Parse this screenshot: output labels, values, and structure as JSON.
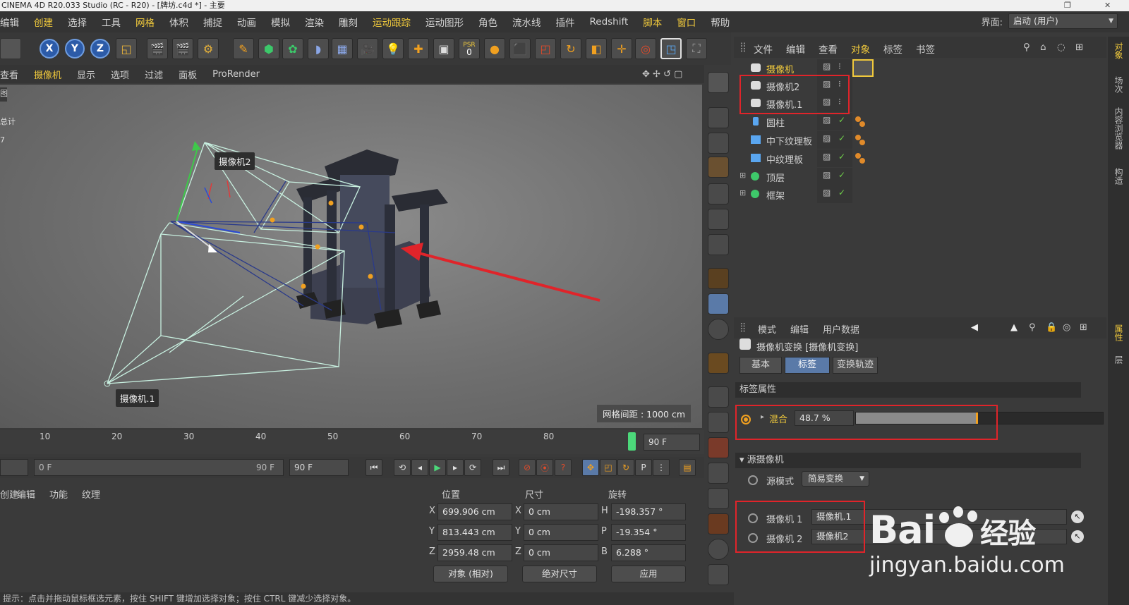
{
  "window": {
    "title": "CINEMA 4D R20.033 Studio (RC - R20) - [牌坊.c4d *] - 主要"
  },
  "menubar": {
    "items": [
      "编辑",
      "创建",
      "选择",
      "工具",
      "网格",
      "体积",
      "捕捉",
      "动画",
      "模拟",
      "渲染",
      "雕刻",
      "运动跟踪",
      "运动图形",
      "角色",
      "流水线",
      "插件",
      "Redshift",
      "脚本",
      "窗口",
      "帮助"
    ],
    "highlight_color": "#f0c93c"
  },
  "interface": {
    "label": "界面:",
    "value": "启动 (用户)"
  },
  "toolbar": {
    "axis_x": "X",
    "axis_y": "Y",
    "axis_z": "Z",
    "psr_label": "PSR",
    "psr_value": "0"
  },
  "viewport_menu": {
    "items": [
      "查看",
      "摄像机",
      "显示",
      "选项",
      "过滤",
      "面板",
      "ProRender"
    ]
  },
  "viewport": {
    "side_text_1": "图",
    "side_text_2": "总计",
    "side_text_3": "7",
    "cam2_label": "摄像机2",
    "cam1_label": "摄像机.1",
    "grid_info": "网格间距 : 1000 cm"
  },
  "timeline": {
    "ticks": [
      "10",
      "20",
      "30",
      "40",
      "50",
      "60",
      "70",
      "80"
    ],
    "current_frame": "90 F"
  },
  "transport": {
    "start_field": "0 F",
    "range_start": "0 F",
    "range_end": "90 F",
    "end_field": "90 F"
  },
  "material_menu": {
    "items": [
      "创建",
      "编辑",
      "功能",
      "纹理"
    ]
  },
  "coords": {
    "headers": {
      "position": "位置",
      "size": "尺寸",
      "rotation": "旋转"
    },
    "rows": [
      {
        "p_axis": "X",
        "p_val": "699.906 cm",
        "s_axis": "X",
        "s_val": "0 cm",
        "r_axis": "H",
        "r_val": "-198.357 °"
      },
      {
        "p_axis": "Y",
        "p_val": "813.443 cm",
        "s_axis": "Y",
        "s_val": "0 cm",
        "r_axis": "P",
        "r_val": "-19.354 °"
      },
      {
        "p_axis": "Z",
        "p_val": "2959.48 cm",
        "s_axis": "Z",
        "s_val": "0 cm",
        "r_axis": "B",
        "r_val": "6.288 °"
      }
    ],
    "mode_select": "对象 (相对)",
    "size_select": "绝对尺寸",
    "apply_button": "应用"
  },
  "status": {
    "text": "提示：点击并拖动鼠标框选元素，按住 SHIFT 键增加选择对象；按住 CTRL 键减少选择对象。"
  },
  "object_menu": {
    "items": [
      "文件",
      "编辑",
      "查看",
      "对象",
      "标签",
      "书签"
    ]
  },
  "objects": [
    {
      "name": "摄像机",
      "type": "camera",
      "active": true
    },
    {
      "name": "摄像机2",
      "type": "camera",
      "active": false
    },
    {
      "name": "摄像机.1",
      "type": "camera",
      "active": false
    },
    {
      "name": "圆柱",
      "type": "cylinder",
      "active": false
    },
    {
      "name": "中下纹理板",
      "type": "cube",
      "active": false
    },
    {
      "name": "中纹理板",
      "type": "cube",
      "active": false
    },
    {
      "name": "顶层",
      "type": "null",
      "active": false
    },
    {
      "name": "框架",
      "type": "null",
      "active": false
    }
  ],
  "attr_menu": {
    "items": [
      "模式",
      "编辑",
      "用户数据"
    ]
  },
  "attributes": {
    "title": "摄像机变换 [摄像机变换]",
    "tabs": [
      "基本",
      "标签",
      "变换轨迹"
    ],
    "active_tab": "标签",
    "section_tag": "标签属性",
    "blend_label": "混合",
    "blend_value": "48.7 %",
    "blend_fraction": 0.487,
    "section_source": "▾ 源摄像机",
    "source_mode_label": "源模式",
    "source_mode_value": "简易变换",
    "camera1_label": "摄像机 1",
    "camera1_value": "摄像机.1",
    "camera2_label": "摄像机 2",
    "camera2_value": "摄像机2"
  },
  "right_strip": {
    "tabs_top": [
      "对象",
      "场次",
      "内容浏览器",
      "构造"
    ],
    "tabs_bottom": [
      "属性",
      "层"
    ]
  },
  "watermark": {
    "brand": "Bai",
    "brand2": "经验",
    "url": "jingyan.baidu.com"
  }
}
